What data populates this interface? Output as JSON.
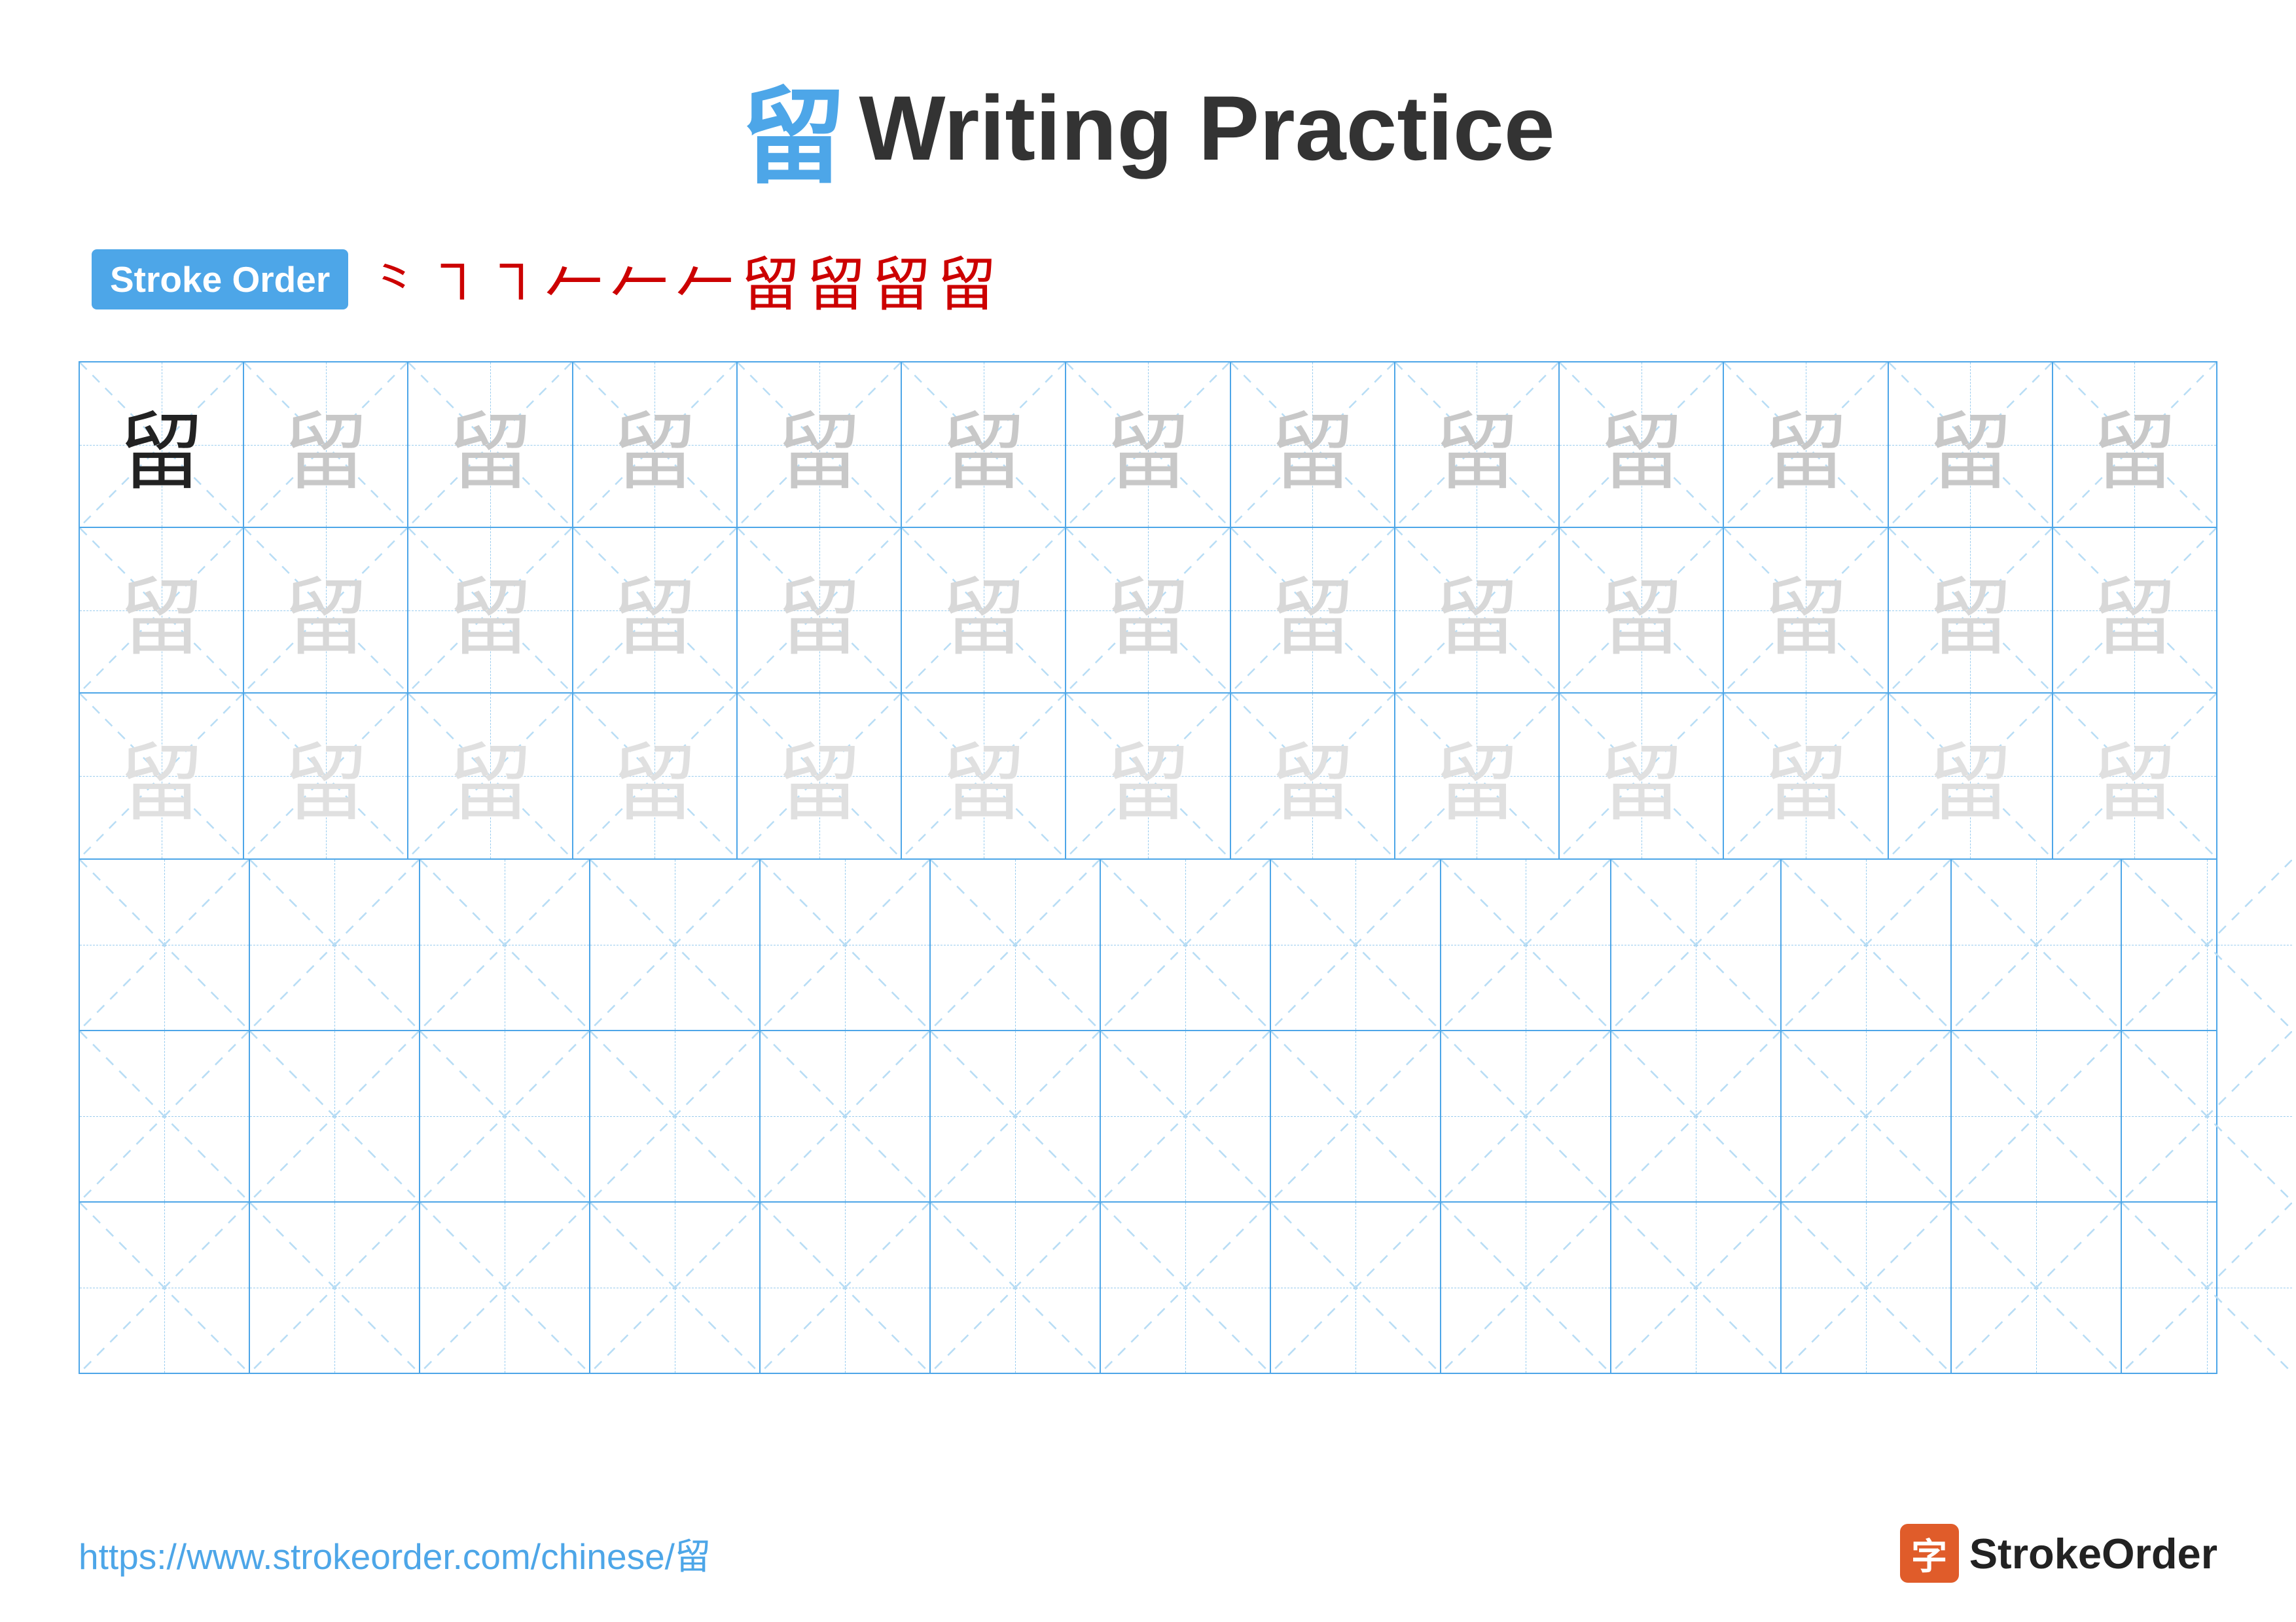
{
  "title": {
    "char": "留",
    "text": "Writing Practice"
  },
  "stroke_order": {
    "badge": "Stroke Order",
    "strokes": [
      "㇒",
      "㇓",
      "㇔",
      "𠃊",
      "𠃋",
      "𠃌",
      "留",
      "留",
      "留",
      "留"
    ]
  },
  "grid": {
    "rows": 6,
    "cols": 13,
    "char": "留",
    "practice_char": "留",
    "url": "https://www.strokeorder.com/chinese/留",
    "logo_char": "字",
    "logo_text": "StrokeOrder"
  }
}
